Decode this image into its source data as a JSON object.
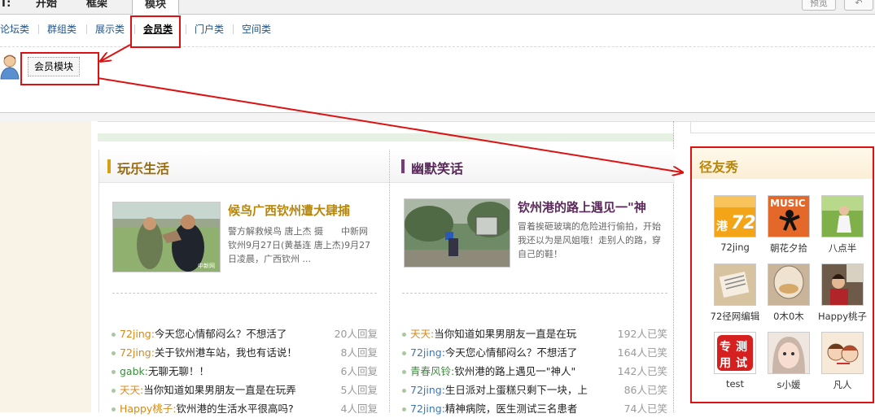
{
  "top_tabs": {
    "partial_left": "T:",
    "tab1": "开始",
    "tab2": "框架",
    "active": "模块"
  },
  "top_buttons": {
    "btn1": "预览",
    "btn2": ""
  },
  "categories": [
    "论坛类",
    "群组类",
    "展示类",
    "会员类",
    "门户类",
    "空间类"
  ],
  "module_button": "会员模块",
  "left_panel": {
    "title": "玩乐生活",
    "headline": "候鸟广西钦州遭大肆捕",
    "summary": "警方解救候鸟 唐上杰 摄　　中新网钦州9月27日(黄基连 唐上杰)9月27日凌晨，广西钦州 ...",
    "rows": [
      {
        "user": "72jing:",
        "text": "今天您心情郁闷么？不想活了",
        "count": "20人回复"
      },
      {
        "user": "72jing:",
        "text": "关于钦州港车站，我也有话说！",
        "count": "8人回复"
      },
      {
        "user": "gabk:",
        "text": "无聊无聊！！",
        "count": "6人回复"
      },
      {
        "user": "天天:",
        "text": "当你知道如果男朋友一直是在玩弄",
        "count": "5人回复"
      },
      {
        "user": "Happy桃子:",
        "text": "钦州港的生活水平很高吗?",
        "count": "4人回复"
      }
    ]
  },
  "right_panel": {
    "title": "幽默笑话",
    "headline": "钦州港的路上遇见一\"神",
    "summary": "冒着挨砸玻璃的危险进行偷拍，开始我还以为是风姐哦！走别人的路，穿自己的鞋！",
    "rows": [
      {
        "user": "天天:",
        "text": "当你知道如果男朋友一直是在玩",
        "count": "192人已笑"
      },
      {
        "user": "72jing:",
        "text": "今天您心情郁闷么？不想活了",
        "count": "164人已笑"
      },
      {
        "user": "青春风铃:",
        "text": "钦州港的路上遇见一\"神人\"",
        "count": "142人已笑"
      },
      {
        "user": "72jing:",
        "text": "生日派对上蛋糕只剩下一块，上",
        "count": "86人已笑"
      },
      {
        "user": "72jing:",
        "text": "精神病院，医生测试三名患者",
        "count": "74人已笑"
      }
    ]
  },
  "friends": {
    "title": "径友秀",
    "items": [
      {
        "name": "72jing",
        "icon": "72-logo-avatar"
      },
      {
        "name": "朝花夕拾",
        "icon": "music-dancer-avatar"
      },
      {
        "name": "八点半",
        "icon": "girl-outdoor-avatar"
      },
      {
        "name": "72径网编辑",
        "icon": "newspaper-avatar"
      },
      {
        "name": "0木0木",
        "icon": "wine-glass-avatar"
      },
      {
        "name": "Happy桃子",
        "icon": "girl-room-avatar"
      },
      {
        "name": "test",
        "icon": "test-stamp-avatar"
      },
      {
        "name": "s小媛",
        "icon": "girl-face-avatar"
      },
      {
        "name": "凡人",
        "icon": "cartoon-couple-avatar"
      }
    ]
  },
  "colors": {
    "annotation_red": "#dd1111",
    "title_accent": "#d4a017",
    "link_blue": "#3b78b5"
  }
}
